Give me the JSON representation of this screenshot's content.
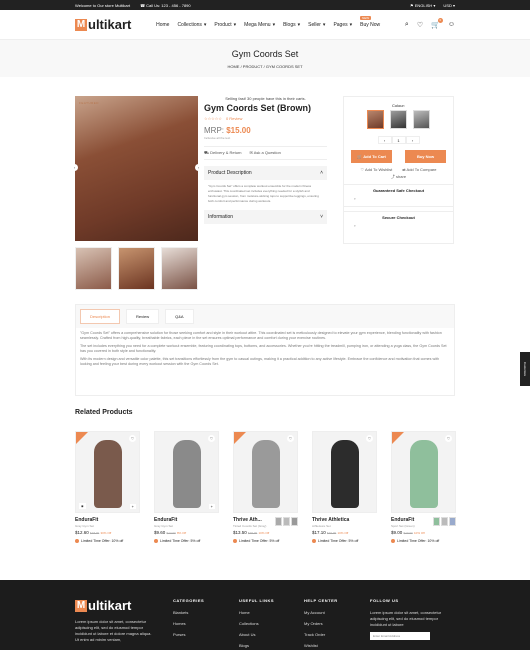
{
  "topbar": {
    "welcome": "Welcome to Our store Multikart",
    "phone": "Call Us: 123 - 456 - 7890",
    "language": "ENGLISH",
    "currency": "USD"
  },
  "header": {
    "logo_letter": "M",
    "logo_rest": "ultikart",
    "nav": [
      "Home",
      "Collections",
      "Product",
      "Mega Menu",
      "Blogs",
      "Seller",
      "Pages",
      "Buy Now"
    ],
    "new_badge": "NEW",
    "cart_count": "0"
  },
  "breadcrumb": {
    "title": "Gym Coords Set",
    "trail": "HOME  /  PRODUCT  /  GYM COORDS SET"
  },
  "product": {
    "featured": "FEATURED",
    "selling": "Selling fast! 30 people have this in their carts.",
    "name": "Gym Coords Set (Brown)",
    "stars": "☆☆☆☆☆",
    "reviews": "0 Review",
    "mrp_label": "MRP:",
    "price": "$15.00",
    "tax": "Inclusive all the text",
    "delivery": "Delivery & Return",
    "ask": "Ask a Question",
    "desc_title": "Product Description",
    "desc_text": "\"Gym Coords Set\" offers a complete workout ensemble for the modern fitness enthusiast. This coordinated set includes everything needed for a stylish and functional gym session, from moisture-wicking tops to supportive leggings, ensuring both comfort and performance during workouts.",
    "info_title": "Information"
  },
  "buy": {
    "colour_label": "Colour:",
    "qty": "1",
    "add_to_cart": "Add To Cart",
    "buy_now": "Buy Now",
    "wishlist": "Add To Wishlist",
    "compare": "Add To Compare",
    "share": "share",
    "safe_checkout": "Guaranteed Safe Checkout",
    "secure_checkout": "Secure Checkout"
  },
  "tabs": {
    "items": [
      "Description",
      "Review",
      "Q&A"
    ],
    "p1": "\"Gym Coords Set\" offers a comprehensive solution for those seeking comfort and style in their workout attire. This coordinated set is meticulously designed to elevate your gym experience, blending functionality with fashion seamlessly. Crafted from high-quality, breathable fabrics, each piece in the set ensures optimal performance and comfort during your exercise routines.",
    "p2": "The set includes everything you need for a complete workout ensemble, featuring coordinating tops, bottoms, and accessories. Whether you're hitting the treadmill, pumping iron, or attending a yoga class, the Gym Coords Set has you covered in both style and functionality.",
    "p3": "With its modern design and versatile color palette, this set transitions effortlessly from the gym to casual outings, making it a practical addition to any active lifestyle. Embrace the confidence and motivation that comes with looking and feeling your best during every workout session with the Gym Coords Set."
  },
  "side_tab": "Customize",
  "related": {
    "title": "Related Products",
    "items": [
      {
        "title": "EnduraFit",
        "sub": "Gray Gym Set",
        "price": "$12.60",
        "old": "$18.00",
        "off": "30% Off",
        "limit": "Limited Time Offer: 10% off",
        "color": "#7a5a4c"
      },
      {
        "title": "EnduraFit",
        "sub": "Gray Gym Set",
        "price": "$9.60",
        "old": "$12.00",
        "off": "8% Off",
        "limit": "Limited Time Offer: 5% off",
        "color": "#8a8a8a"
      },
      {
        "title": "Thrive Ath...",
        "sub": "Tinted Coords Set (Gray)",
        "price": "$13.50",
        "old": "$15.00",
        "off": "10% Off",
        "limit": "Limited Time Offer: 5% off",
        "color": "#9a9a9a"
      },
      {
        "title": "Thrive Athletica",
        "sub": "Athleisure Set",
        "price": "$17.10",
        "old": "$19.00",
        "off": "10% Off",
        "limit": "Limited Time Offer: 5% off",
        "color": "#2c2c2c"
      },
      {
        "title": "EnduraFit",
        "sub": "Sport Set (Green)",
        "price": "$9.00",
        "old": "$10.00",
        "off": "10% Off",
        "limit": "Limited Time Offer: 10% off",
        "color": "#8fbf9c"
      }
    ]
  },
  "footer": {
    "about": "Lorem ipsum dolor sit amet, consectetur adipiscing elit, sed do eiusmod tempor incididunt ut labore et dolore magna aliqua. Ut enim ad minim veniam,",
    "cols": [
      {
        "title": "CATEGORIES",
        "items": [
          "Blankets",
          "Homes",
          "Purses"
        ]
      },
      {
        "title": "USEFUL LINKS",
        "items": [
          "Home",
          "Collections",
          "About Us",
          "Blogs"
        ]
      },
      {
        "title": "HELP CENTER",
        "items": [
          "My Account",
          "My Orders",
          "Track Order",
          "Wishlist"
        ]
      }
    ],
    "follow": "FOLLOW US",
    "follow_text": "Lorem ipsum dolor sit amet, consectetur adipiscing elit, sed do eiusmod tempor incididunt ut labore",
    "email_placeholder": "Enter Email Address"
  }
}
